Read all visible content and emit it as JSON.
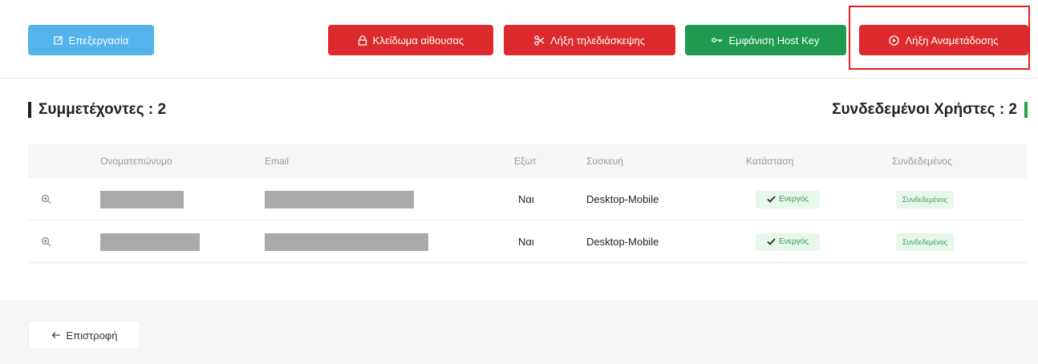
{
  "toolbar": {
    "edit_label": "Επεξεργασία",
    "lock_room_label": "Κλείδωμα αίθουσας",
    "end_conference_label": "Λήξη τηλεδιάσκεψης",
    "show_host_key_label": "Εμφάνιση Host Key",
    "end_stream_label": "Λήξη Αναμετάδοσης"
  },
  "participants": {
    "title": "Συμμετέχοντες : 2",
    "connected_title": "Συνδεδεμένοι Χρήστες : 2"
  },
  "table": {
    "headers": [
      "Ονοματεπώνυμο",
      "Email",
      "Εξωτ",
      "Συσκευή",
      "Κατάσταση",
      "Συνδεδεμένος"
    ],
    "rows": [
      {
        "external": "Ναι",
        "device": "Desktop-Mobile",
        "status": "Ενεργός",
        "connected": "Συνδεδεμένος"
      },
      {
        "external": "Ναι",
        "device": "Desktop-Mobile",
        "status": "Ενεργός",
        "connected": "Συνδεδεμένος"
      }
    ]
  },
  "footer": {
    "back_label": "Επιστροφή"
  },
  "colors": {
    "primary_blue": "#54b3ea",
    "danger_red": "#dd2a2d",
    "success_green": "#1e9b4f",
    "highlight_outline": "#e32020"
  }
}
